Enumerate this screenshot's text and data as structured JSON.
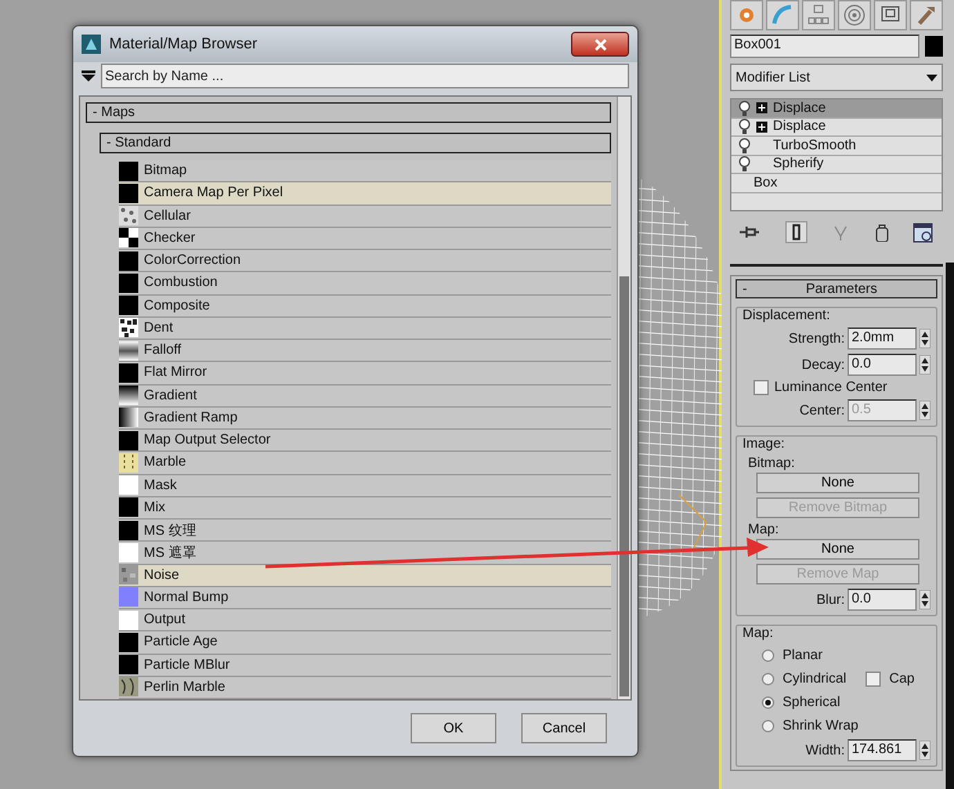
{
  "dialog": {
    "title": "Material/Map Browser",
    "search": {
      "placeholder": "Search by Name ..."
    },
    "maps_header": "- Maps",
    "standard_header": "- Standard",
    "items": [
      {
        "label": "Bitmap",
        "kind": "black",
        "highlighted": false
      },
      {
        "label": "Camera Map Per Pixel",
        "kind": "black",
        "highlighted": true
      },
      {
        "label": "Cellular",
        "kind": "cellular",
        "highlighted": false
      },
      {
        "label": "Checker",
        "kind": "checker",
        "highlighted": false
      },
      {
        "label": "ColorCorrection",
        "kind": "black",
        "highlighted": false
      },
      {
        "label": "Combustion",
        "kind": "black",
        "highlighted": false
      },
      {
        "label": "Composite",
        "kind": "black",
        "highlighted": false
      },
      {
        "label": "Dent",
        "kind": "dent",
        "highlighted": false
      },
      {
        "label": "Falloff",
        "kind": "falloff",
        "highlighted": false
      },
      {
        "label": "Flat Mirror",
        "kind": "black",
        "highlighted": false
      },
      {
        "label": "Gradient",
        "kind": "gradient",
        "highlighted": false
      },
      {
        "label": "Gradient Ramp",
        "kind": "ramp",
        "highlighted": false
      },
      {
        "label": "Map Output Selector",
        "kind": "black",
        "highlighted": false
      },
      {
        "label": "Marble",
        "kind": "marble",
        "highlighted": false
      },
      {
        "label": "Mask",
        "kind": "white",
        "highlighted": false
      },
      {
        "label": "Mix",
        "kind": "black",
        "highlighted": false
      },
      {
        "label": "MS 纹理",
        "kind": "black",
        "highlighted": false
      },
      {
        "label": "MS 遮罩",
        "kind": "white",
        "highlighted": false
      },
      {
        "label": "Noise",
        "kind": "noise",
        "highlighted": true
      },
      {
        "label": "Normal Bump",
        "kind": "blue",
        "highlighted": false
      },
      {
        "label": "Output",
        "kind": "white",
        "highlighted": false
      },
      {
        "label": "Particle Age",
        "kind": "black",
        "highlighted": false
      },
      {
        "label": "Particle MBlur",
        "kind": "black",
        "highlighted": false
      },
      {
        "label": "Perlin Marble",
        "kind": "perlin",
        "highlighted": false
      }
    ],
    "buttons": [
      "OK",
      "Cancel"
    ]
  },
  "command_panel": {
    "object_name": "Box001",
    "modifier_list": "Modifier List",
    "stack": [
      {
        "label": "Displace",
        "kind": "modifier",
        "expandable": true,
        "selected": true
      },
      {
        "label": "Displace",
        "kind": "modifier",
        "expandable": true,
        "selected": false
      },
      {
        "label": "TurboSmooth",
        "kind": "modifier",
        "expandable": false,
        "selected": false
      },
      {
        "label": "Spherify",
        "kind": "modifier",
        "expandable": false,
        "selected": false
      },
      {
        "label": "Box",
        "kind": "base",
        "expandable": false,
        "selected": false
      }
    ],
    "rollout_toggle": "-",
    "rollout_title": "Parameters",
    "displacement": {
      "title": "Displacement:",
      "strength": {
        "label": "Strength:",
        "value": "2.0mm",
        "disabled": false
      },
      "decay": {
        "label": "Decay:",
        "value": "0.0",
        "disabled": false
      },
      "luminance": {
        "label": "Luminance Center",
        "checked": false
      },
      "center": {
        "label": "Center:",
        "value": "0.5",
        "disabled": true
      }
    },
    "image": {
      "title": "Image:",
      "bitmap_label": "Bitmap:",
      "bitmap_button": {
        "label": "None",
        "disabled": false
      },
      "remove_bitmap": {
        "label": "Remove Bitmap",
        "disabled": true
      },
      "map_label": "Map:",
      "map_button": {
        "label": "None",
        "disabled": false
      },
      "remove_map": {
        "label": "Remove Map",
        "disabled": true
      },
      "blur": {
        "label": "Blur:",
        "value": "0.0",
        "disabled": false
      }
    },
    "map": {
      "title": "Map:",
      "options": [
        {
          "label": "Planar",
          "selected": false
        },
        {
          "label": "Cylindrical",
          "selected": false
        },
        {
          "label": "Spherical",
          "selected": true
        },
        {
          "label": "Shrink Wrap",
          "selected": false
        }
      ],
      "cap": {
        "label": "Cap",
        "checked": false
      },
      "width": {
        "label": "Width:",
        "value": "174.861",
        "disabled": false
      }
    }
  }
}
